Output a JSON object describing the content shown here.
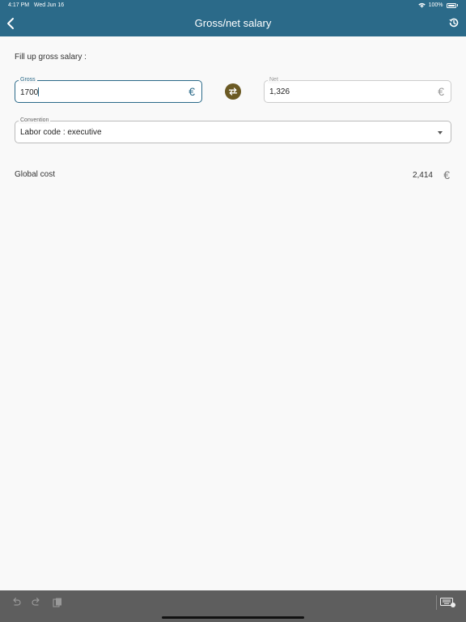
{
  "status_bar": {
    "time": "4:17 PM",
    "date": "Wed Jun 16",
    "battery": "100%"
  },
  "header": {
    "title": "Gross/net salary",
    "back_icon": "chevron-left-icon",
    "history_icon": "history-icon"
  },
  "prompt": "Fill up gross salary :",
  "gross": {
    "label": "Gross",
    "value": "1700",
    "currency": "€"
  },
  "net": {
    "label": "Net",
    "value": "1,326",
    "currency": "€"
  },
  "swap_icon": "swap-arrows-icon",
  "convention": {
    "label": "Convention",
    "value": "Labor code : executive"
  },
  "global_cost": {
    "label": "Global cost",
    "value": "2,414",
    "currency": "€"
  },
  "colors": {
    "header": "#2b6a89",
    "swap": "#6b5a24",
    "toolbar": "#5e5e5e"
  }
}
